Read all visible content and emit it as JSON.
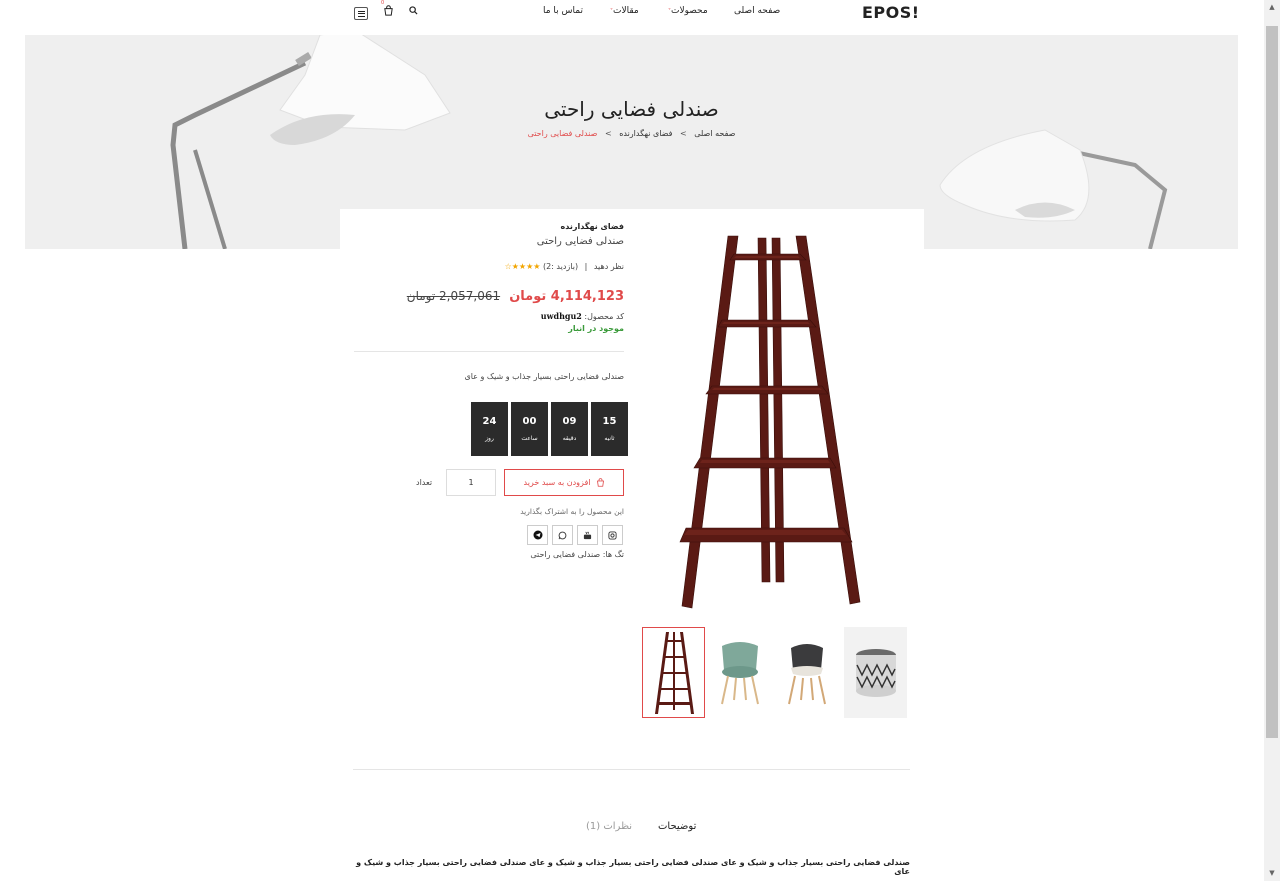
{
  "header": {
    "brand": "EPOS!",
    "nav": [
      {
        "label": "صفحه اصلی",
        "has_caret": false
      },
      {
        "label": "محصولات",
        "has_caret": true
      },
      {
        "label": "مقالات",
        "has_caret": true
      },
      {
        "label": "تماس با ما",
        "has_caret": false
      }
    ],
    "cart_count": "0"
  },
  "hero": {
    "title": "صندلی فضایی راحتی",
    "breadcrumb": [
      "صفحه اصلی",
      "فضای نهگدارنده",
      "صندلی فضایی راحتی"
    ],
    "separator": ">"
  },
  "product": {
    "category": "فضای نهگدارنده",
    "name": "صندلی فضایی راحتی",
    "rating_label": "نظر دهید",
    "visits_label": "(بازدید :2)",
    "rating_value": 4,
    "rating_max": 5,
    "price_new": "4,114,123 تومان",
    "price_old": "2,057,061 تومان",
    "sku_label": "کد محصول:",
    "sku_value": "uwdhgu2",
    "stock": "موجود در انبار",
    "short_description": "صندلی فضایی راحتی بسیار جذاب و شیک و عای",
    "countdown": [
      {
        "value": "24",
        "label": "روز"
      },
      {
        "value": "00",
        "label": "ساعت"
      },
      {
        "value": "09",
        "label": "دقیقه"
      },
      {
        "value": "15",
        "label": "ثانیه"
      }
    ],
    "add_to_cart": "افزودن به سبد خرید",
    "quantity": "1",
    "quantity_label": "تعداد",
    "share_label": "این محصول را به اشتراک بگذارید",
    "socials": [
      "telegram-icon",
      "whatsapp-icon",
      "youtube-icon",
      "instagram-icon"
    ],
    "tags": "تگ ها: صندلی فضایی راحتی"
  },
  "gallery": {
    "thumbnails": [
      "corner-shelf",
      "green-chair",
      "grey-chair",
      "pouf"
    ],
    "active_index": 0
  },
  "tabs": [
    {
      "label": "توضیحات",
      "active": true
    },
    {
      "label": "نظرات (1)",
      "active": false
    }
  ],
  "description": "صندلی فضایی راحتی بسیار جذاب و شیک و عای صندلی فضایی راحتی بسیار جذاب و شیک و عای صندلی فضایی راحتی بسیار جذاب و شیک و عای",
  "colors": {
    "accent": "#e04a4a",
    "stock": "#3a9a3a",
    "star": "#f2a500",
    "countdown_bg": "#2b2b2b"
  }
}
